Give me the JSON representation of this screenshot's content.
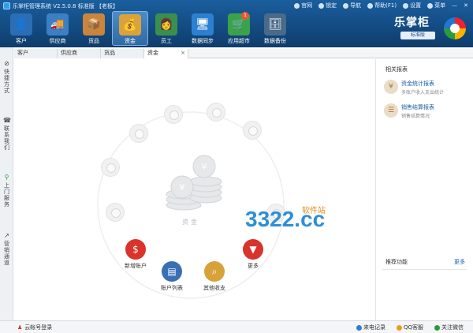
{
  "app": {
    "title": "乐掌柜管理系统 V2.5.0.8 标准版 【老板】"
  },
  "topmenu": [
    {
      "icon": "home-icon",
      "label": "官网"
    },
    {
      "icon": "lock-icon",
      "label": "锁定"
    },
    {
      "icon": "nav-icon",
      "label": "导航"
    },
    {
      "icon": "help-icon",
      "label": "帮助(F1)"
    },
    {
      "icon": "gear-icon",
      "label": "设置"
    },
    {
      "icon": "menu-icon",
      "label": "菜单"
    }
  ],
  "toolbar": [
    {
      "name": "customers",
      "label": "客户",
      "icon": "customer-icon",
      "color": "#2a6fb5"
    },
    {
      "name": "suppliers",
      "label": "供应商",
      "icon": "supplier-icon",
      "color": "#3b80c4"
    },
    {
      "name": "goods",
      "label": "货品",
      "icon": "goods-icon",
      "color": "#c9863b"
    },
    {
      "name": "funds",
      "label": "资金",
      "icon": "funds-icon",
      "color": "#d9a23a"
    },
    {
      "name": "staff",
      "label": "员工",
      "icon": "staff-icon",
      "color": "#3a8f4f"
    },
    {
      "name": "sync",
      "label": "数据同步",
      "icon": "sync-icon",
      "color": "#2d7fd1"
    },
    {
      "name": "appstore",
      "label": "应用超市",
      "icon": "cart-icon",
      "color": "#3aa24a",
      "badge": "1"
    },
    {
      "name": "backup",
      "label": "数据备份",
      "icon": "backup-icon",
      "color": "#4a6a8a"
    }
  ],
  "brand": {
    "name": "乐掌柜",
    "edition": "标准版"
  },
  "sidebar": [
    {
      "icon": "compass-icon",
      "label": "快捷方式"
    },
    {
      "icon": "phone-icon",
      "label": "联系我们"
    },
    {
      "icon": "bike-icon",
      "label": "上门服务"
    },
    {
      "icon": "chart-icon",
      "label": "营销通道"
    }
  ],
  "tabs": [
    {
      "label": "客户"
    },
    {
      "label": "供应商"
    },
    {
      "label": "货品"
    },
    {
      "label": "资金",
      "closable": "×"
    }
  ],
  "center": {
    "label": "资金",
    "actions": [
      {
        "name": "new-account",
        "label": "新增账户",
        "icon": "money-bag-icon",
        "color": "#d9342b"
      },
      {
        "name": "account-list",
        "label": "账户列表",
        "icon": "card-icon",
        "color": "#3b6fb5"
      },
      {
        "name": "other-income",
        "label": "其他收支",
        "icon": "magnifier-icon",
        "color": "#d8a23a"
      },
      {
        "name": "more",
        "label": "更多",
        "icon": "more-icon",
        "color": "#d9342b"
      }
    ]
  },
  "watermark": {
    "text": "3322.cc",
    "sub": "软件站"
  },
  "rightpanel": {
    "title": "相关报表",
    "reports": [
      {
        "title": "资金统计报表",
        "desc": "多账户收入支出统计"
      },
      {
        "title": "销售结算报表",
        "desc": "销售结算情况"
      }
    ],
    "recommend": "推荐功能",
    "more": "更多"
  },
  "statusbar": {
    "cloud_login": "云帐号登录",
    "right": [
      {
        "icon": "phone-icon",
        "label": "来电记录"
      },
      {
        "icon": "qq-icon",
        "label": "QQ客服"
      },
      {
        "icon": "wechat-icon",
        "label": "关注微信"
      }
    ]
  }
}
